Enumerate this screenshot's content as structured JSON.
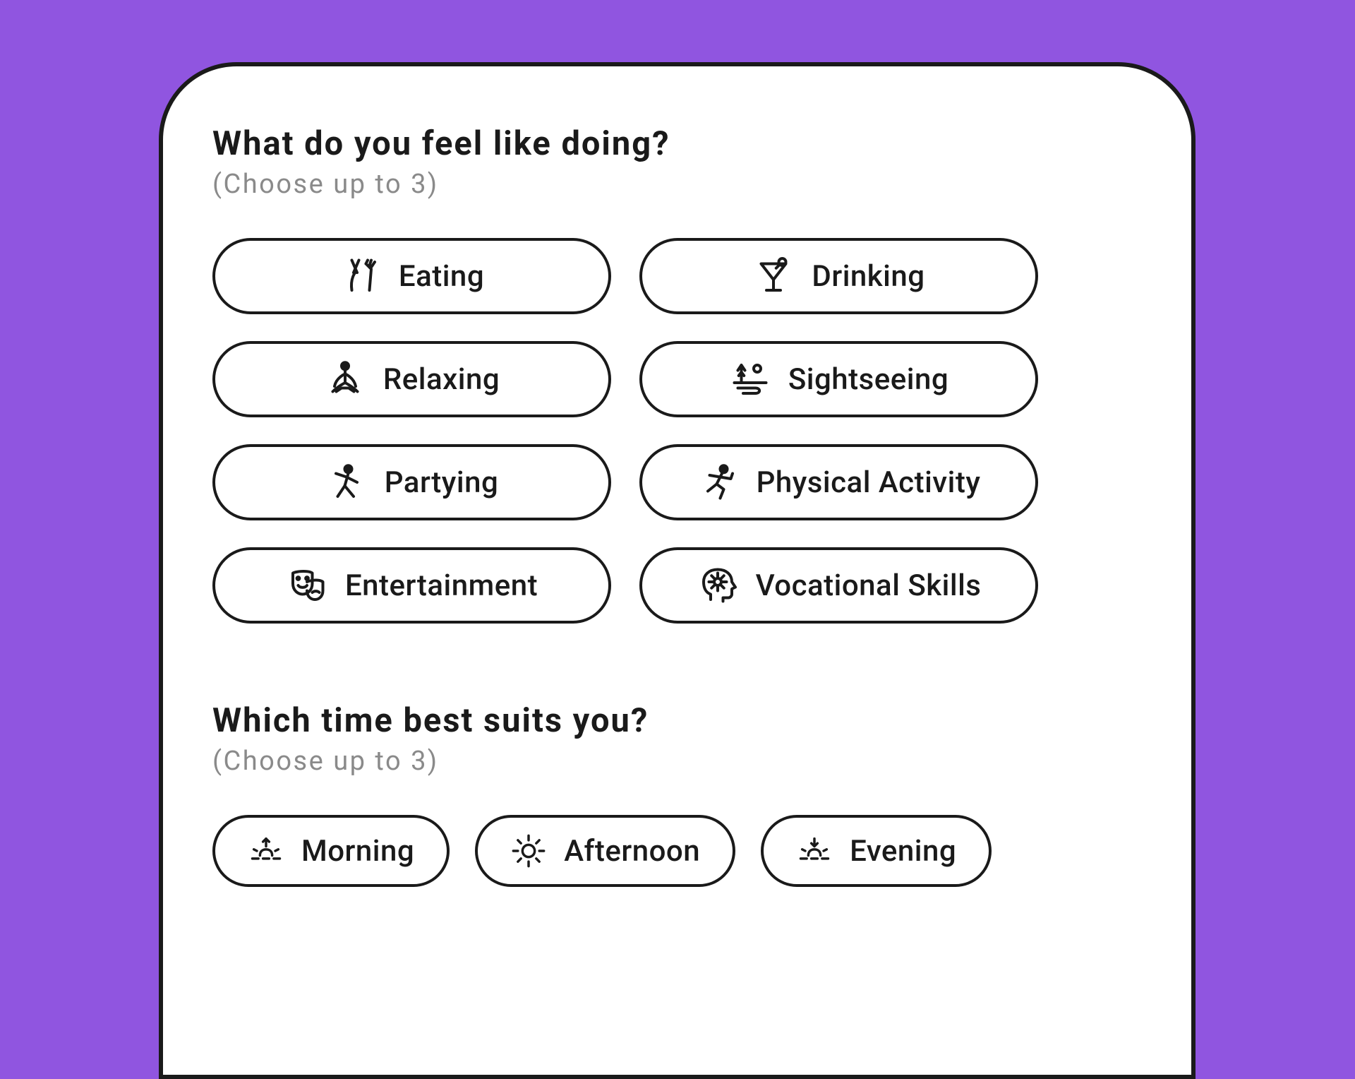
{
  "sections": {
    "activities": {
      "title": "What do you feel like doing?",
      "subtitle": "(Choose up to 3)",
      "options": [
        {
          "label": "Eating"
        },
        {
          "label": "Drinking"
        },
        {
          "label": "Relaxing"
        },
        {
          "label": "Sightseeing"
        },
        {
          "label": "Partying"
        },
        {
          "label": "Physical Activity"
        },
        {
          "label": "Entertainment"
        },
        {
          "label": "Vocational Skills"
        }
      ]
    },
    "times": {
      "title": "Which time best suits you?",
      "subtitle": "(Choose up to 3)",
      "options": [
        {
          "label": "Morning"
        },
        {
          "label": "Afternoon"
        },
        {
          "label": "Evening"
        }
      ]
    }
  },
  "colors": {
    "background": "#9055e0",
    "card": "#ffffff",
    "border": "#1a1a1a",
    "text": "#1a1a1a",
    "muted": "#8a8a8a"
  }
}
